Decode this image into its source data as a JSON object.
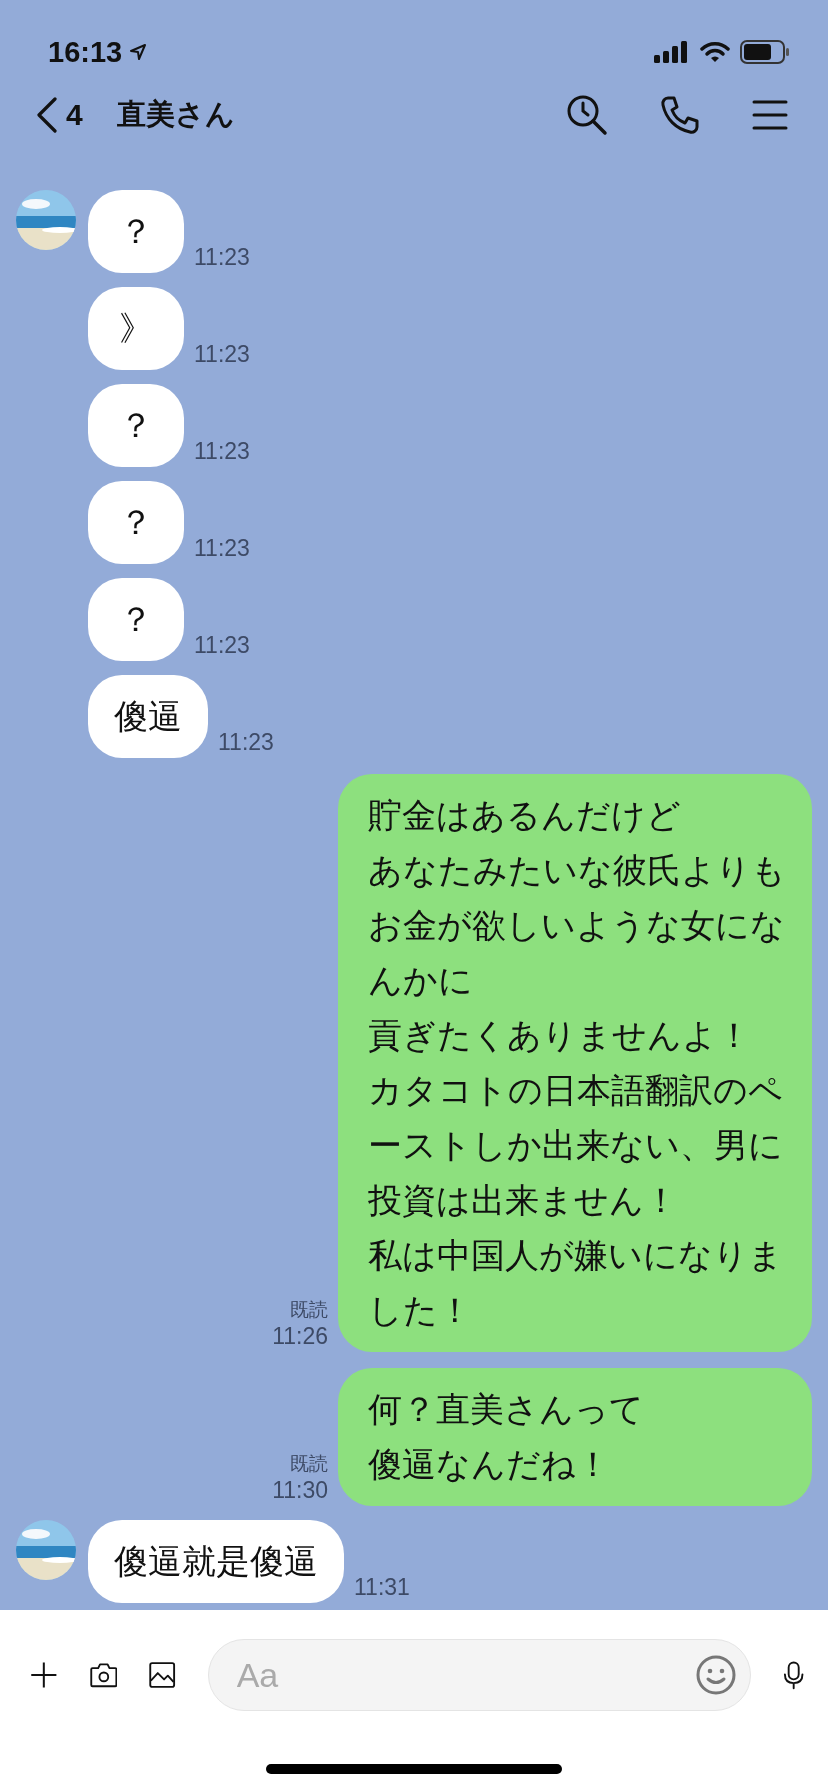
{
  "status_bar": {
    "time": "16:13"
  },
  "header": {
    "back_count": "4",
    "title": "直美さん"
  },
  "messages": [
    {
      "kind": "incoming",
      "avatar": true,
      "lines": [
        "？"
      ],
      "time": "11:23"
    },
    {
      "kind": "incoming",
      "avatar": false,
      "lines": [
        "》"
      ],
      "time": "11:23"
    },
    {
      "kind": "incoming",
      "avatar": false,
      "lines": [
        "？"
      ],
      "time": "11:23"
    },
    {
      "kind": "incoming",
      "avatar": false,
      "lines": [
        "？"
      ],
      "time": "11:23"
    },
    {
      "kind": "incoming",
      "avatar": false,
      "lines": [
        "？"
      ],
      "time": "11:23"
    },
    {
      "kind": "incoming",
      "avatar": false,
      "lines": [
        "傻逼"
      ],
      "time": "11:23"
    },
    {
      "kind": "outgoing",
      "lines": [
        "貯金はあるんだけど",
        "あなたみたいな彼氏よりも",
        "お金が欲しいような女になんかに",
        "貢ぎたくありませんよ！",
        "カタコトの日本語翻訳のペーストしか出来ない、男に投資は出来ません！",
        "私は中国人が嫌いになりました！"
      ],
      "time": "11:26",
      "read_label": "既読"
    },
    {
      "kind": "outgoing",
      "lines": [
        "何？直美さんって",
        "傻逼なんだね！"
      ],
      "time": "11:30",
      "read_label": "既読"
    },
    {
      "kind": "incoming",
      "avatar": true,
      "lines": [
        "傻逼就是傻逼"
      ],
      "time": "11:31"
    }
  ],
  "composer": {
    "placeholder": "Aa"
  }
}
